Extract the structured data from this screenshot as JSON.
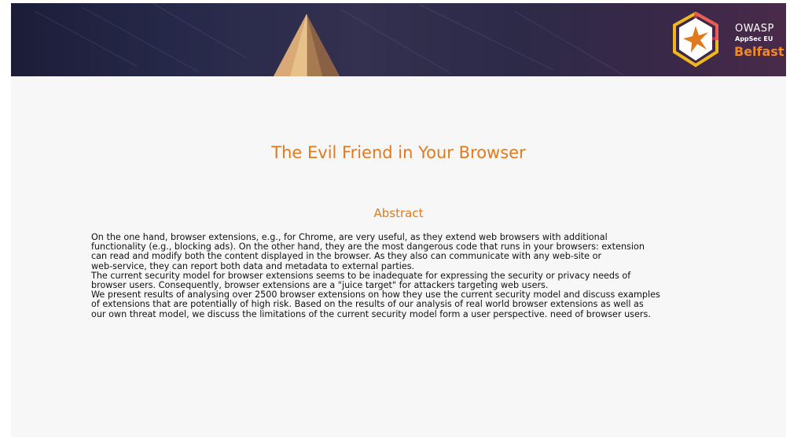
{
  "banner": {
    "logo": {
      "line1": "OWASP",
      "line2": "AppSec EU",
      "line3": "Belfast"
    }
  },
  "title": "The Evil Friend in Your Browser",
  "abstract": {
    "heading": "Abstract",
    "lines": [
      "On the one hand, browser extensions, e.g., for Chrome, are very useful, as they extend web browsers with additional",
      "functionality (e.g., blocking ads). On the other hand, they are the most dangerous code that runs in your browsers: extension",
      "can read and modify both the content displayed in the browser. As they also can communicate with any web-site or",
      "web-service, they can report both data and metadata to external parties.",
      "The current security model for browser extensions seems to be inadequate for expressing the security or privacy needs of",
      "browser users. Consequently, browser extensions are a \"juice target\" for attackers targeting web users.",
      "We present results of analysing over 2500 browser extensions on how they use the current security model and discuss examples",
      "of extensions that are potentially of high risk. Based on the results of our analysis of real world browser extensions as well as",
      "our own threat model, we discuss the limitations of the current security model form a user perspective. need of browser users."
    ]
  }
}
